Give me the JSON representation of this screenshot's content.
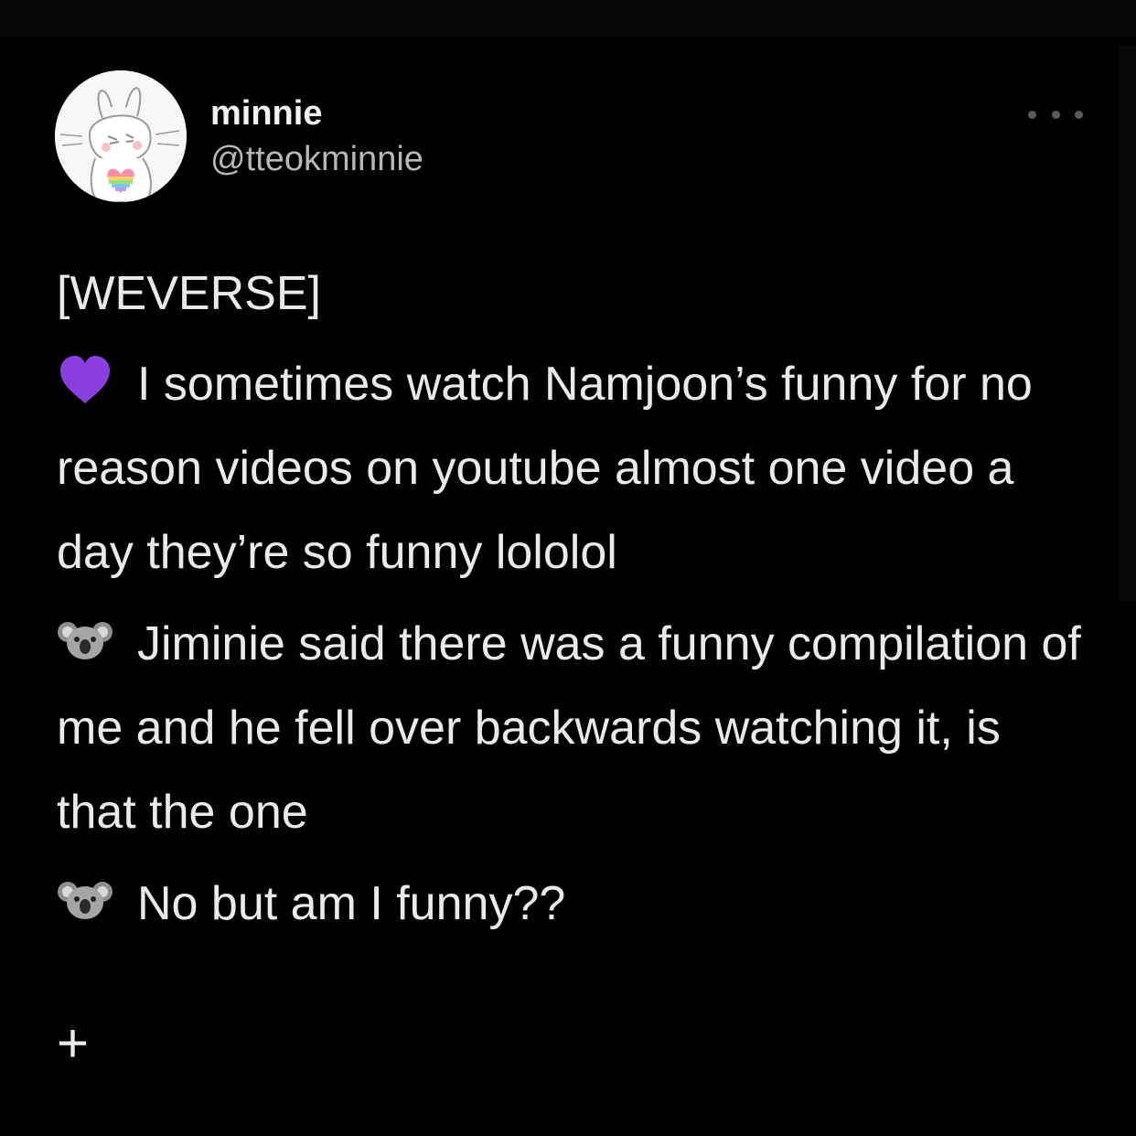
{
  "tweet": {
    "author": {
      "display_name": "minnie",
      "handle": "@tteokminnie",
      "avatar": "white-bunny-holding-rainbow-heart-icon"
    },
    "more_icon": "more-horizontal-icon",
    "source_tag": "[WEVERSE]",
    "quotes": [
      {
        "emoji": "purple-heart-icon",
        "text": "I sometimes watch Namjoon’s funny for no reason videos on youtube almost one video a day they’re so funny lololol"
      },
      {
        "emoji": "koala-icon",
        "text": "Jiminie said there was a funny compilation of me and he fell over backwards watching it, is that the one"
      },
      {
        "emoji": "koala-icon",
        "text": "No but am I funny??"
      }
    ],
    "continuation_mark": "+"
  },
  "colors": {
    "background": "#000000",
    "text_primary": "#eaeaea",
    "text_secondary": "#b7b7b7",
    "purple_heart": "#8b3fe0"
  }
}
